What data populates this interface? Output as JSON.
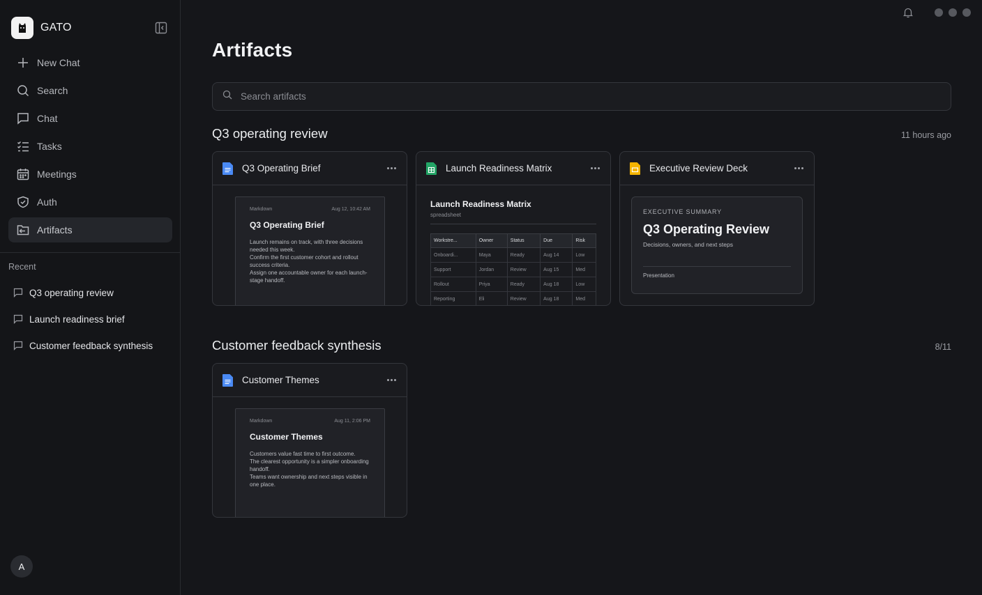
{
  "app": {
    "name": "GATO"
  },
  "sidebar": {
    "items": [
      {
        "label": "New Chat",
        "icon": "plus-icon"
      },
      {
        "label": "Search",
        "icon": "search-icon"
      },
      {
        "label": "Chat",
        "icon": "chat-icon"
      },
      {
        "label": "Tasks",
        "icon": "tasks-icon"
      },
      {
        "label": "Meetings",
        "icon": "calendar-icon"
      },
      {
        "label": "Auth",
        "icon": "shield-icon"
      },
      {
        "label": "Artifacts",
        "icon": "folder-icon",
        "active": true
      }
    ],
    "recent_title": "Recent",
    "recent": [
      {
        "label": "Q3 operating review"
      },
      {
        "label": "Launch readiness brief"
      },
      {
        "label": "Customer feedback synthesis"
      }
    ],
    "avatar_initial": "A"
  },
  "main": {
    "title": "Artifacts",
    "search_placeholder": "Search artifacts",
    "sections": [
      {
        "title": "Q3 operating review",
        "meta": "11 hours ago",
        "cards": [
          {
            "title": "Q3 Operating Brief",
            "type": "doc",
            "preview": {
              "kind": "Markdown",
              "date": "Aug 12, 10:42 AM",
              "title": "Q3 Operating Brief",
              "lines": [
                "Launch remains on track, with three decisions needed this week.",
                "Confirm the first customer cohort and rollout success criteria.",
                "Assign one accountable owner for each launch-stage handoff."
              ]
            }
          },
          {
            "title": "Launch Readiness Matrix",
            "type": "sheet",
            "preview": {
              "title": "Launch Readiness Matrix",
              "subtitle": "spreadsheet",
              "headers": [
                "Workstre...",
                "Owner",
                "Status",
                "Due",
                "Risk"
              ],
              "rows": [
                [
                  "Onboardi...",
                  "Maya",
                  "Ready",
                  "Aug 14",
                  "Low"
                ],
                [
                  "Support",
                  "Jordan",
                  "Review",
                  "Aug 15",
                  "Med"
                ],
                [
                  "Rollout",
                  "Priya",
                  "Ready",
                  "Aug 18",
                  "Low"
                ],
                [
                  "Reporting",
                  "Eli",
                  "Review",
                  "Aug 18",
                  "Med"
                ]
              ]
            }
          },
          {
            "title": "Executive Review Deck",
            "type": "slides",
            "preview": {
              "kicker": "EXECUTIVE SUMMARY",
              "title": "Q3 Operating Review",
              "subtitle": "Decisions, owners, and next steps",
              "footer": "Presentation"
            }
          }
        ]
      },
      {
        "title": "Customer feedback synthesis",
        "meta": "8/11",
        "cards": [
          {
            "title": "Customer Themes",
            "type": "doc",
            "preview": {
              "kind": "Markdown",
              "date": "Aug 11, 2:06 PM",
              "title": "Customer Themes",
              "lines": [
                "Customers value fast time to first outcome.",
                "The clearest opportunity is a simpler onboarding handoff.",
                "Teams want ownership and next steps visible in one place."
              ]
            }
          }
        ]
      }
    ]
  },
  "colors": {
    "background": "#15161a",
    "sidebar": "#141518",
    "doc_icon": "#4a8af4",
    "sheet_icon": "#23a566",
    "slides_icon": "#f4b400"
  }
}
